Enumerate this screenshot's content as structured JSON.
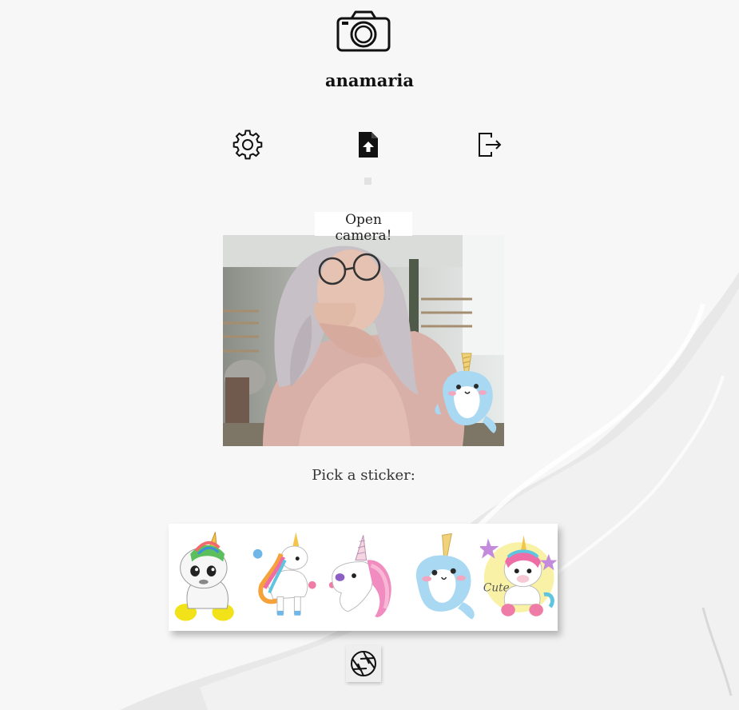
{
  "header": {
    "logo_icon": "camera-icon",
    "username": "anamaria"
  },
  "nav": {
    "items": [
      {
        "name": "settings",
        "icon": "gear-icon"
      },
      {
        "name": "upload",
        "icon": "file-upload-icon"
      },
      {
        "name": "logout",
        "icon": "logout-icon"
      }
    ]
  },
  "camera": {
    "open_label": "Open camera!",
    "overlay_sticker": "narwhal"
  },
  "stickers": {
    "label": "Pick a sticker:",
    "items": [
      "unicorn-sitting-white",
      "unicorn-running",
      "unicorn-head-pink",
      "narwhal",
      "unicorn-cute-sitting"
    ]
  },
  "shutter": {
    "icon": "shutter-icon"
  },
  "colors": {
    "background": "#f7f7f7",
    "swoosh": "#e6e6e6",
    "narwhal": "#a9d8f2"
  }
}
